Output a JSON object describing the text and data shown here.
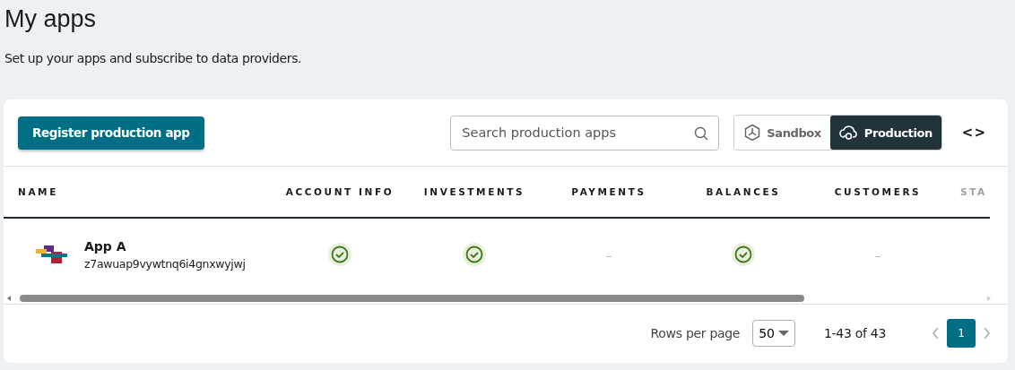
{
  "header": {
    "title": "My apps",
    "subtitle": "Set up your apps and subscribe to data providers."
  },
  "toolbar": {
    "register_button": "Register production app",
    "search": {
      "placeholder": "Search production apps"
    },
    "environments": [
      {
        "label": "Sandbox",
        "kind": "sandbox",
        "selected": false
      },
      {
        "label": "Production",
        "kind": "production",
        "selected": true
      }
    ],
    "scroll_arrows": "<>"
  },
  "table": {
    "columns": [
      "NAME",
      "ACCOUNT INFO",
      "INVESTMENTS",
      "PAYMENTS",
      "BALANCES",
      "CUSTOMERS",
      "STA"
    ],
    "rows": [
      {
        "cells": [
          {
            "kind": "app",
            "name": "App A",
            "id": "z7awuap9vywtnq6i4gnxwyjwj"
          },
          {
            "kind": "check"
          },
          {
            "kind": "check"
          },
          {
            "kind": "dash",
            "text": "–"
          },
          {
            "kind": "check"
          },
          {
            "kind": "dash",
            "text": "–"
          }
        ]
      }
    ]
  },
  "pagination": {
    "rows_per_page_label": "Rows per page",
    "rows_per_page": "50",
    "range": "1-43 of 43",
    "pages": [
      {
        "label": "1",
        "selected": true
      }
    ]
  }
}
